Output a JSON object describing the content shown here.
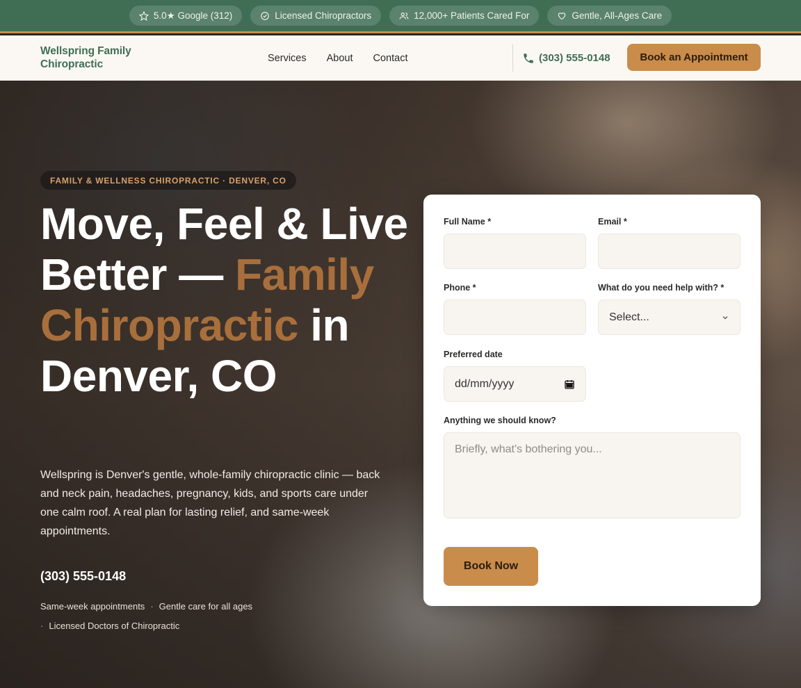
{
  "trust_bar": [
    {
      "icon": "star-icon",
      "label": "5.0★ Google (312)"
    },
    {
      "icon": "badge-check-icon",
      "label": "Licensed Chiropractors"
    },
    {
      "icon": "users-icon",
      "label": "12,000+ Patients Cared For"
    },
    {
      "icon": "heart-icon",
      "label": "Gentle, All-Ages Care"
    }
  ],
  "header": {
    "logo": "Wellspring Family Chiropractic",
    "nav": [
      "Services",
      "About",
      "Contact"
    ],
    "phone": "(303) 555-0148",
    "cta": "Book an Appointment"
  },
  "hero": {
    "eyebrow": "FAMILY & WELLNESS CHIROPRACTIC · DENVER, CO",
    "headline_part1": "Move, Feel & Live Better —",
    "headline_accent": "Family Chiropractic",
    "headline_part2": "in Denver, CO",
    "lede": "Wellspring is Denver's gentle, whole-family chiropractic clinic — back and neck pain, headaches, pregnancy, kids, and sports care under one calm roof. A real plan for lasting relief, and same-week appointments.",
    "phone": "(303) 555-0148",
    "perks": [
      "Same-week appointments",
      "Gentle care for all ages",
      "Licensed Doctors of Chiropractic"
    ]
  },
  "form": {
    "full_name_label": "Full Name *",
    "email_label": "Email *",
    "phone_label": "Phone *",
    "help_label": "What do you need help with? *",
    "help_value": "Select...",
    "date_label": "Preferred date",
    "date_placeholder": "dd/mm/yyyy",
    "notes_label": "Anything we should know?",
    "notes_placeholder": "Briefly, what's bothering you...",
    "submit": "Book Now"
  },
  "colors": {
    "brand_green": "#3f6e54",
    "accent_orange": "#c98c4a",
    "headline_accent": "#a86f3c"
  }
}
